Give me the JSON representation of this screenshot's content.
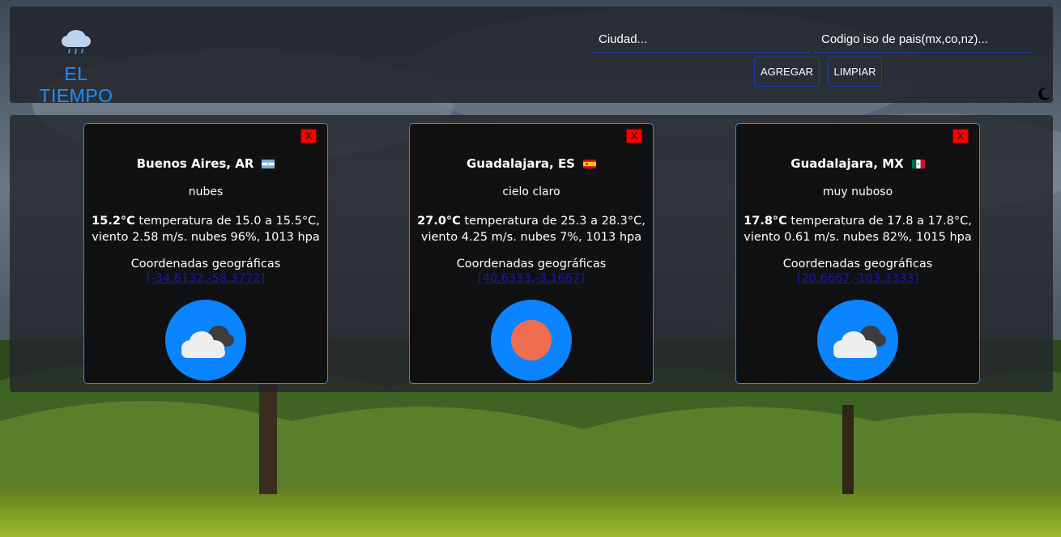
{
  "app": {
    "title": "EL TIEMPO",
    "logo_icon": "rain-cloud-icon",
    "accent": "#1e90ff"
  },
  "search": {
    "city_placeholder": "Ciudad...",
    "iso_placeholder": "Codigo iso de pais(mx,co,nz)...",
    "add_label": "AGREGAR",
    "clear_label": "LIMPIAR"
  },
  "theme_toggle": {
    "icon": "moon-icon"
  },
  "cards": [
    {
      "city": "Buenos Aires, AR",
      "flag": "flag-ar-icon",
      "description": "nubes",
      "temp": "15.2°C",
      "range_text": "temperatura de 15.0 a 15.5°C,",
      "wind_text": "viento 2.58 m/s. nubes 96%, 1013 hpa",
      "coords_label": "Coordenadas geográficas",
      "coords": "[-34.6132,-58.3772]",
      "close_label": "X",
      "weather_icon": "clouds-icon"
    },
    {
      "city": "Guadalajara, ES",
      "flag": "flag-es-icon",
      "description": "cielo claro",
      "temp": "27.0°C",
      "range_text": "temperatura de 25.3 a 28.3°C,",
      "wind_text": "viento 4.25 m/s. nubes 7%, 1013 hpa",
      "coords_label": "Coordenadas geográficas",
      "coords": "[40.6333,-3.1667]",
      "close_label": "X",
      "weather_icon": "sun-icon"
    },
    {
      "city": "Guadalajara, MX",
      "flag": "flag-mx-icon",
      "description": "muy nuboso",
      "temp": "17.8°C",
      "range_text": "temperatura de 17.8 a 17.8°C,",
      "wind_text": "viento 0.61 m/s. nubes 82%, 1015 hpa",
      "coords_label": "Coordenadas geográficas",
      "coords": "[20.6667,-103.3333]",
      "close_label": "X",
      "weather_icon": "clouds-icon"
    }
  ]
}
